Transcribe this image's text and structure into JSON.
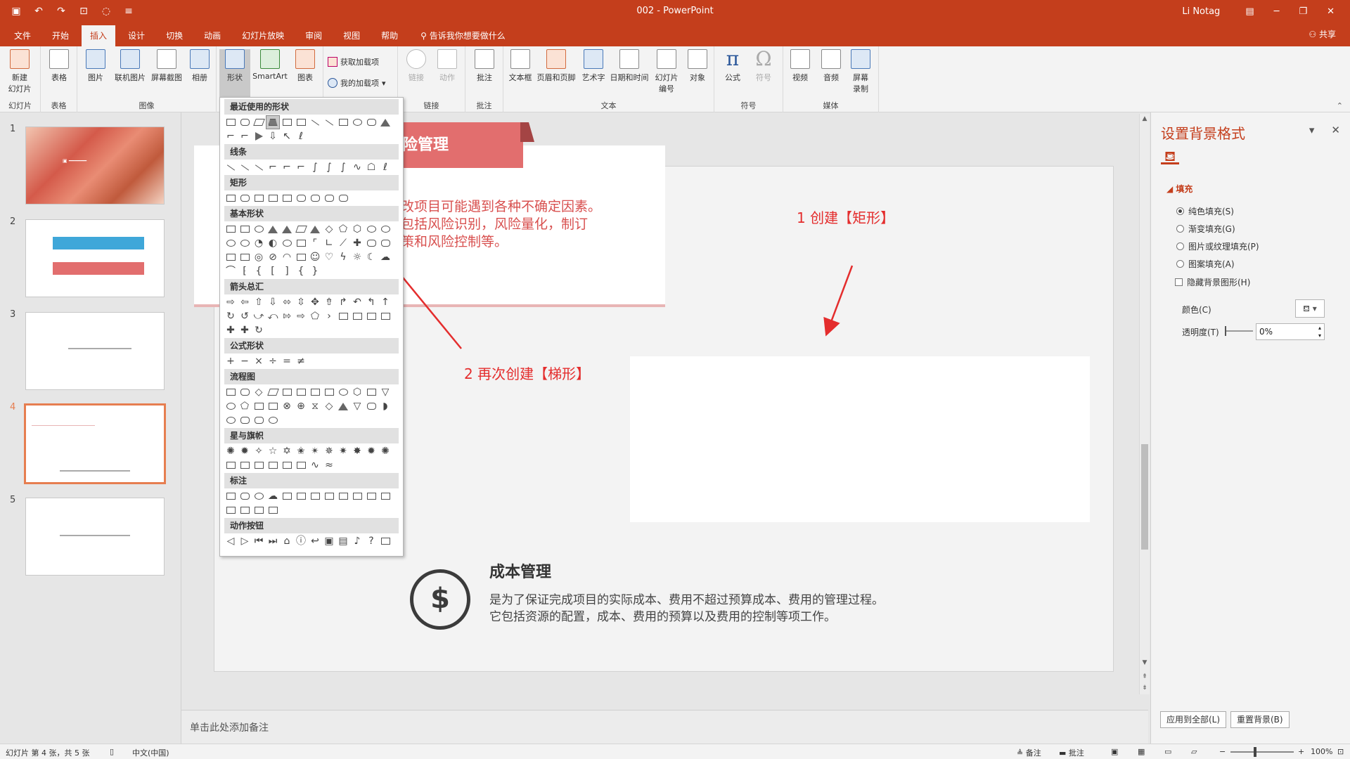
{
  "titlebar": {
    "title": "002 - PowerPoint",
    "user": "Li Notag",
    "qat_icons": [
      "save-icon",
      "undo-icon",
      "redo-icon",
      "present-icon",
      "touch-icon",
      "customize-icon"
    ]
  },
  "tabs": [
    "文件",
    "开始",
    "插入",
    "设计",
    "切换",
    "动画",
    "幻灯片放映",
    "审阅",
    "视图",
    "帮助"
  ],
  "active_tab": "插入",
  "tellme": "告诉我你想要做什么",
  "share": "共享",
  "ribbon": {
    "groups": {
      "slides": {
        "label": "幻灯片",
        "new_slide": "新建\n幻灯片"
      },
      "tables": {
        "label": "表格",
        "table": "表格"
      },
      "images": {
        "label": "图像",
        "picture": "图片",
        "online_picture": "联机图片",
        "screenshot": "屏幕截图",
        "album": "相册"
      },
      "illustrations": {
        "shapes": "形状",
        "smartart": "SmartArt",
        "chart": "图表"
      },
      "addins": {
        "get": "获取加载项",
        "mine": "我的加载项"
      },
      "links": {
        "label": "链接",
        "link": "链接",
        "action": "动作"
      },
      "comments": {
        "label": "批注",
        "comment": "批注"
      },
      "text": {
        "label": "文本",
        "textbox": "文本框",
        "header_footer": "页眉和页脚",
        "wordart": "艺术字",
        "datetime": "日期和时间",
        "slide_number": "幻灯片\n编号",
        "object": "对象"
      },
      "symbols": {
        "label": "符号",
        "equation": "公式",
        "symbol": "符号"
      },
      "media": {
        "label": "媒体",
        "video": "视频",
        "audio": "音频",
        "screen_recording": "屏幕\n录制"
      }
    }
  },
  "thumbnails": {
    "numbers": [
      "1",
      "2",
      "3",
      "4",
      "5"
    ],
    "selected": 4
  },
  "slide": {
    "banner_title": "险管理",
    "card_text": [
      "改项目可能遇到各种不确定因素。",
      "包括风险识别，风险量化，制订",
      "策和风险控制等。"
    ],
    "cost_title": "成本管理",
    "cost_lines": [
      "是为了保证完成项目的实际成本、费用不超过预算成本、费用的管理过程。",
      "它包括资源的配置，成本、费用的预算以及费用的控制等项工作。"
    ],
    "annotation1": "1 创建【矩形】",
    "annotation2": "2 再次创建【梯形】",
    "annotation_color": "#e42d2d"
  },
  "notes_placeholder": "单击此处添加备注",
  "shapes_dropdown": {
    "sections": [
      "最近使用的形状",
      "线条",
      "矩形",
      "基本形状",
      "箭头总汇",
      "公式形状",
      "流程图",
      "星与旗帜",
      "标注",
      "动作按钮"
    ]
  },
  "format_pane": {
    "title": "设置背景格式",
    "fill_heading": "填充",
    "options": [
      "纯色填充(S)",
      "渐变填充(G)",
      "图片或纹理填充(P)",
      "图案填充(A)"
    ],
    "selected_option": "纯色填充(S)",
    "hide_bg": "隐藏背景图形(H)",
    "color_label": "颜色(C)",
    "transparency_label": "透明度(T)",
    "transparency_value": "0%",
    "apply_all": "应用到全部(L)",
    "reset_bg": "重置背景(B)"
  },
  "statusbar": {
    "slide_info": "幻灯片 第 4 张，共 5 张",
    "language": "中文(中国)",
    "notes": "备注",
    "comments": "批注",
    "zoom": "100%"
  },
  "colors": {
    "accent": "#c43e1c",
    "slide_red": "#e26e6e",
    "thumb_highlight": "#e67e50"
  }
}
